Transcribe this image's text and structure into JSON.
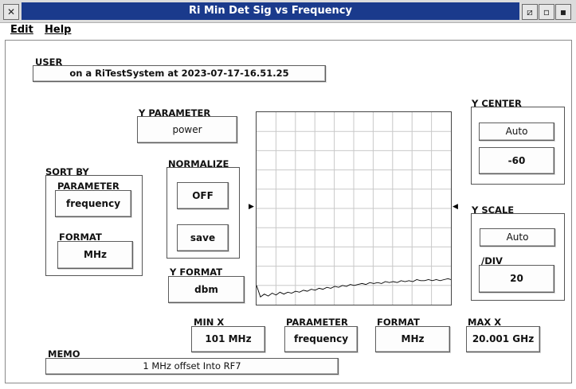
{
  "window": {
    "title": "Ri Min Det Sig vs Frequency"
  },
  "menu": {
    "edit": "Edit",
    "help": "Help"
  },
  "user": {
    "label": "USER",
    "value": "on a RiTestSystem at 2023-07-17-16.51.25"
  },
  "y_parameter": {
    "label": "Y PARAMETER",
    "value": "power"
  },
  "sort_by": {
    "label": "SORT BY",
    "parameter_label": "PARAMETER",
    "parameter_value": "frequency",
    "format_label": "FORMAT",
    "format_value": "MHz"
  },
  "normalize": {
    "label": "NORMALIZE",
    "off_label": "OFF",
    "save_label": "save"
  },
  "y_format": {
    "label": "Y FORMAT",
    "value": "dbm"
  },
  "y_center": {
    "label": "Y CENTER",
    "mode": "Auto",
    "value": "-60"
  },
  "y_scale": {
    "label": "Y SCALE",
    "mode": "Auto",
    "div_label": "/DIV",
    "div_value": "20"
  },
  "x_axis": {
    "min_label": "MIN X",
    "min_value": "101 MHz",
    "param_label": "PARAMETER",
    "param_value": "frequency",
    "format_label": "FORMAT",
    "format_value": "MHz",
    "max_label": "MAX X",
    "max_value": "20.001 GHz"
  },
  "memo": {
    "label": "MEMO",
    "value": "1 MHz offset Into RF7"
  },
  "chart_data": {
    "type": "line",
    "x_unit": "MHz",
    "xlim": [
      101,
      20001
    ],
    "y_unit": "dbm",
    "ylim": [
      -160,
      40
    ],
    "grid": true,
    "grid_divisions": {
      "x": 10,
      "y": 10
    },
    "series": [
      {
        "x": [
          101,
          500,
          900,
          1300,
          1700,
          2100,
          2500,
          2900,
          3300,
          3700,
          4100,
          4500,
          4900,
          5300,
          5700,
          6100,
          6500,
          6900,
          7300,
          7700,
          8100,
          8500,
          8900,
          9300,
          9700,
          10100,
          10500,
          10900,
          11300,
          11700,
          12100,
          12500,
          12900,
          13300,
          13700,
          14100,
          14500,
          14900,
          15300,
          15700,
          16100,
          16500,
          16900,
          17300,
          17700,
          18100,
          18500,
          18900,
          19300,
          19700,
          20001
        ],
        "values": [
          -140,
          -152,
          -149,
          -151,
          -148,
          -150,
          -147,
          -149,
          -147,
          -148,
          -146,
          -147,
          -145,
          -146,
          -144,
          -145,
          -143,
          -144,
          -142,
          -143,
          -141,
          -142,
          -140,
          -141,
          -139,
          -140,
          -139,
          -138,
          -139,
          -137,
          -138,
          -137,
          -138,
          -136,
          -137,
          -136,
          -137,
          -135,
          -136,
          -135,
          -136,
          -134,
          -135,
          -135,
          -134,
          -135,
          -134,
          -135,
          -134,
          -133,
          -134
        ]
      }
    ]
  }
}
